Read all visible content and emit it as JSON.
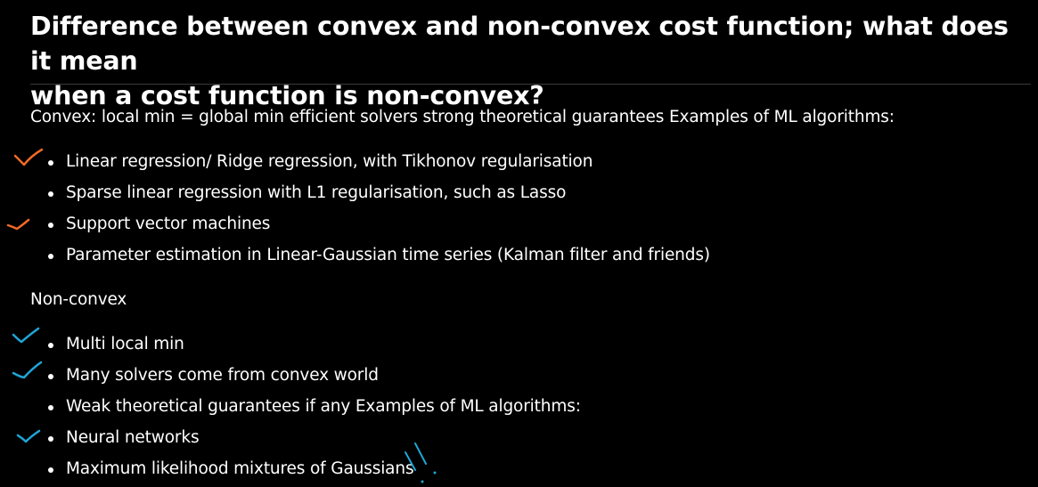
{
  "heading": {
    "line1": "Difference between convex and non-convex cost function; what does it mean",
    "line2": "when a cost function is non-convex?"
  },
  "convex": {
    "intro": "Convex: local min = global min efficient solvers strong theoretical guarantees Examples of ML algorithms:",
    "items": [
      "Linear regression/ Ridge regression, with Tikhonov regularisation",
      "Sparse linear regression with L1 regularisation, such as Lasso",
      "Support vector machines",
      "Parameter estimation in Linear-Gaussian time series (Kalman filter and friends)"
    ]
  },
  "nonconvex": {
    "intro": "Non-convex",
    "items": [
      "Multi local min",
      "Many solvers come from convex world",
      "Weak theoretical guarantees if any Examples of ML algorithms:",
      "Neural networks",
      "Maximum likelihood mixtures of Gaussians"
    ]
  },
  "annotation_colors": {
    "orange": "#f06a28",
    "blue": "#1fa6d8"
  }
}
